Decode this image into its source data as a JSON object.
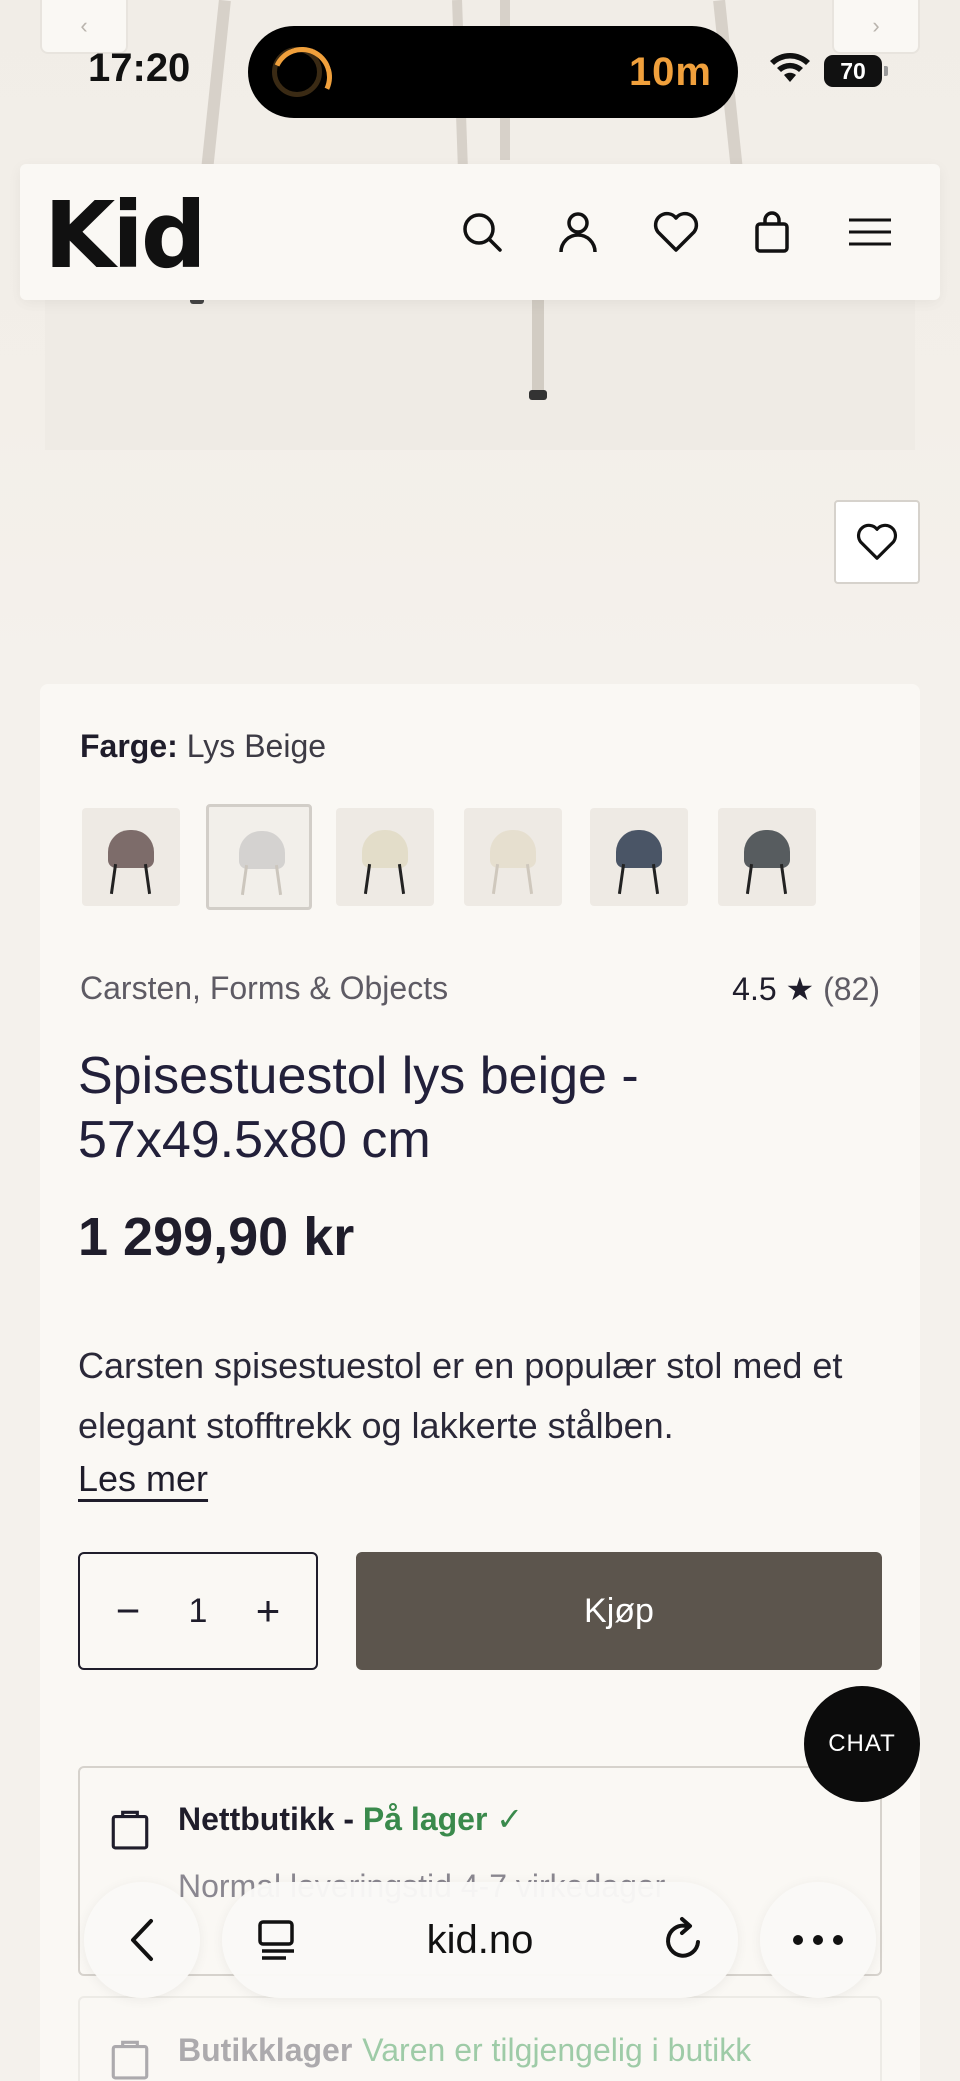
{
  "status_bar": {
    "time": "17:20",
    "timer": "10m",
    "battery": "70"
  },
  "header": {
    "logo": "Kid"
  },
  "product": {
    "color_label": "Farge:",
    "color_value": "Lys Beige",
    "swatches": [
      {
        "name": "rose",
        "color": "#7d6c6a"
      },
      {
        "name": "light-grey",
        "color": "#d4d2d0",
        "selected": true
      },
      {
        "name": "cream",
        "color": "#e3ddc9"
      },
      {
        "name": "beige",
        "color": "#e6dfcf"
      },
      {
        "name": "blue-grey",
        "color": "#4a5566"
      },
      {
        "name": "dark-grey",
        "color": "#575c5f"
      }
    ],
    "brand": "Carsten, Forms & Objects",
    "rating": "4.5 ★",
    "rating_count": "(82)",
    "title": "Spisestuestol lys beige - 57x49.5x80 cm",
    "price": "1 299,90 kr",
    "description": "Carsten spisestuestol er en populær stol med et elegant stofftrekk og lakkerte stålben.",
    "read_more": "Les mer",
    "quantity": "1",
    "minus": "−",
    "plus": "+",
    "buy_label": "Kjøp"
  },
  "stock": {
    "online_title": "Nettbutikk - ",
    "online_status": "På lager ✓",
    "online_sub": "Normal leveringstid 4-7 virkedager",
    "store_title": "Butikklager",
    "store_status": "Varen er tilgjengelig i butikk"
  },
  "chat_label": "CHAT",
  "browser": {
    "url": "kid.no"
  }
}
